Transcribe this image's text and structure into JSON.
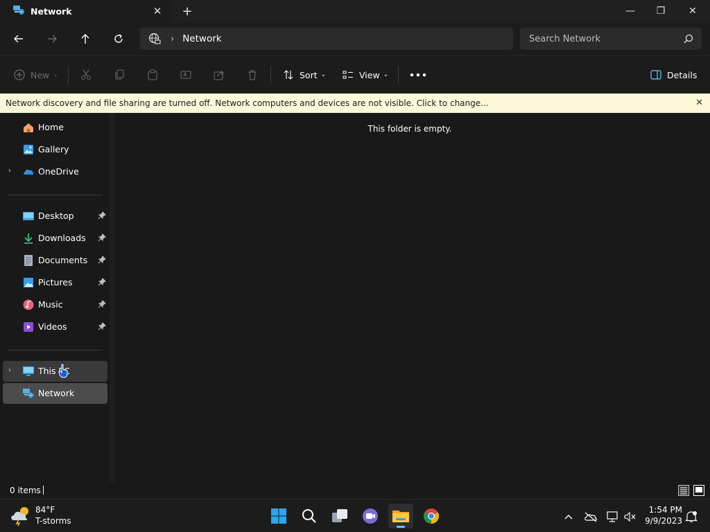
{
  "window": {
    "tab_title": "Network",
    "new_tab_label": "+",
    "minimize_glyph": "—",
    "maximize_glyph": "❐",
    "close_glyph": "✕"
  },
  "address_bar": {
    "separator": "›",
    "location": "Network",
    "search_placeholder": "Search Network"
  },
  "command_bar": {
    "new_label": "New",
    "sort_label": "Sort",
    "view_label": "View",
    "more_label": "•••",
    "details_label": "Details"
  },
  "info_bar": {
    "message": "Network discovery and file sharing are turned off. Network computers and devices are not visible. Click to change...",
    "close_glyph": "✕"
  },
  "nav_pane": {
    "items": [
      {
        "label": "Home",
        "icon": "home-icon"
      },
      {
        "label": "Gallery",
        "icon": "gallery-icon"
      },
      {
        "label": "OneDrive",
        "icon": "onedrive-icon"
      },
      {
        "label": "Desktop",
        "icon": "desktop-icon",
        "pinned": true
      },
      {
        "label": "Downloads",
        "icon": "downloads-icon",
        "pinned": true
      },
      {
        "label": "Documents",
        "icon": "documents-icon",
        "pinned": true
      },
      {
        "label": "Pictures",
        "icon": "pictures-icon",
        "pinned": true
      },
      {
        "label": "Music",
        "icon": "music-icon",
        "pinned": true
      },
      {
        "label": "Videos",
        "icon": "videos-icon",
        "pinned": true
      },
      {
        "label": "This PC",
        "icon": "this-pc-icon"
      },
      {
        "label": "Network",
        "icon": "network-icon",
        "selected": true
      }
    ],
    "expander_glyph": "›"
  },
  "content": {
    "empty_message": "This folder is empty."
  },
  "status_bar": {
    "item_count": "0 items"
  },
  "taskbar": {
    "weather_temp": "84°F",
    "weather_desc": "T-storms",
    "time": "1:54 PM",
    "date": "9/9/2023"
  },
  "colors": {
    "accent": "#60cdff",
    "info_bar_bg": "#fcf8d9",
    "window_bg": "#191919"
  }
}
